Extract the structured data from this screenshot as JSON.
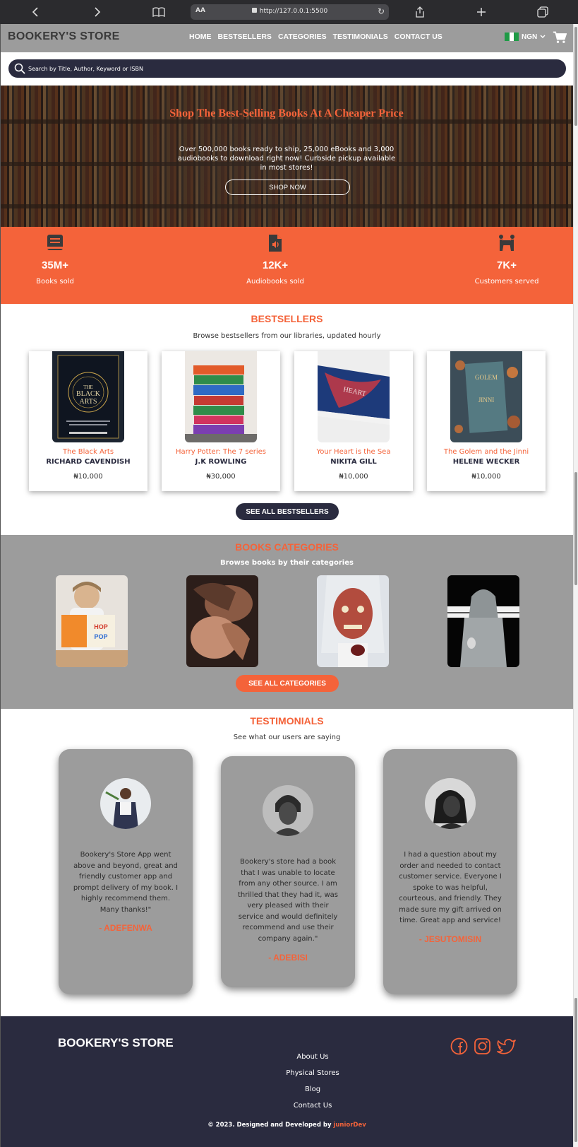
{
  "browser": {
    "text_size_label": "AA",
    "url": "http://127.0.0.1:5500"
  },
  "header": {
    "brand": "BOOKERY'S STORE",
    "nav": [
      "HOME",
      "BESTSELLERS",
      "CATEGORIES",
      "TESTIMONIALS",
      "CONTACT US"
    ],
    "currency": "NGN",
    "flag_colors": [
      "#1f9a46",
      "#ffffff",
      "#1f9a46"
    ]
  },
  "search": {
    "placeholder": "Search by Title, Author, Keyword or ISBN"
  },
  "hero": {
    "title": "Shop The Best-Selling Books At A Cheaper Price",
    "text": "Over 500,000 books ready to ship, 25,000 eBooks and 3,000 audiobooks to download right now! Curbside pickup available in most stores!",
    "button": "SHOP NOW"
  },
  "stats": [
    {
      "icon": "book-icon",
      "value": "35M+",
      "label": "Books sold"
    },
    {
      "icon": "audio-file-icon",
      "value": "12K+",
      "label": "Audiobooks sold"
    },
    {
      "icon": "people-carry-icon",
      "value": "7K+",
      "label": "Customers served"
    }
  ],
  "bestsellers": {
    "title": "BESTSELLERS",
    "subtitle": "Browse bestsellers from our libraries, updated hourly",
    "books": [
      {
        "title": "The Black Arts",
        "author": "RICHARD CAVENDISH",
        "price": "₦10,000",
        "cover_text": "THE BLACK ARTS"
      },
      {
        "title": "Harry Potter: The 7 series",
        "author": "J.K ROWLING",
        "price": "₦30,000",
        "cover_text": ""
      },
      {
        "title": "Your Heart is the Sea",
        "author": "NIKITA GILL",
        "price": "₦10,000",
        "cover_text": "HEART IS THE SEA"
      },
      {
        "title": "The Golem and the Jinni",
        "author": "HELENE WECKER",
        "price": "₦10,000",
        "cover_text": "GOLEM JINNI"
      }
    ],
    "button": "SEE ALL BESTSELLERS"
  },
  "categories": {
    "title": "BOOKS CATEGORIES",
    "subtitle": "Browse books by their categories",
    "items": [
      "children-reading-photo",
      "romance-couple-photo",
      "horror-zombie-photo",
      "mystery-hooded-figure-photo"
    ],
    "button": "SEE ALL CATEGORIES"
  },
  "testimonials": {
    "title": "TESTIMONIALS",
    "subtitle": "See what our users are saying",
    "items": [
      {
        "quote": "Bookery's Store App went above and beyond, great and friendly customer app and prompt delivery of my book. I highly recommend them. Many thanks!\"",
        "name": "- ADEFENWA"
      },
      {
        "quote": "Bookery's store had a book that I was unable to locate from any other source. I am thrilled that they had it, was very pleased with their service and would definitely recommend and use their company again.\"",
        "name": "- ADEBISI"
      },
      {
        "quote": "I had a question about my order and needed to contact customer service. Everyone I spoke to was helpful, courteous, and friendly. They made sure my gift arrived on time. Great app and service!",
        "name": "- JESUTOMISIN"
      }
    ]
  },
  "footer": {
    "brand": "BOOKERY'S STORE",
    "links": [
      "About Us",
      "Physical Stores",
      "Blog",
      "Contact Us"
    ],
    "social": [
      "facebook-icon",
      "instagram-icon",
      "twitter-icon"
    ],
    "copyright": "© 2023. Designed and Developed by ",
    "developer": "juniorDev"
  },
  "colors": {
    "accent": "#f4633a",
    "dark": "#2a2b3f",
    "gray": "#9c9c9c"
  }
}
